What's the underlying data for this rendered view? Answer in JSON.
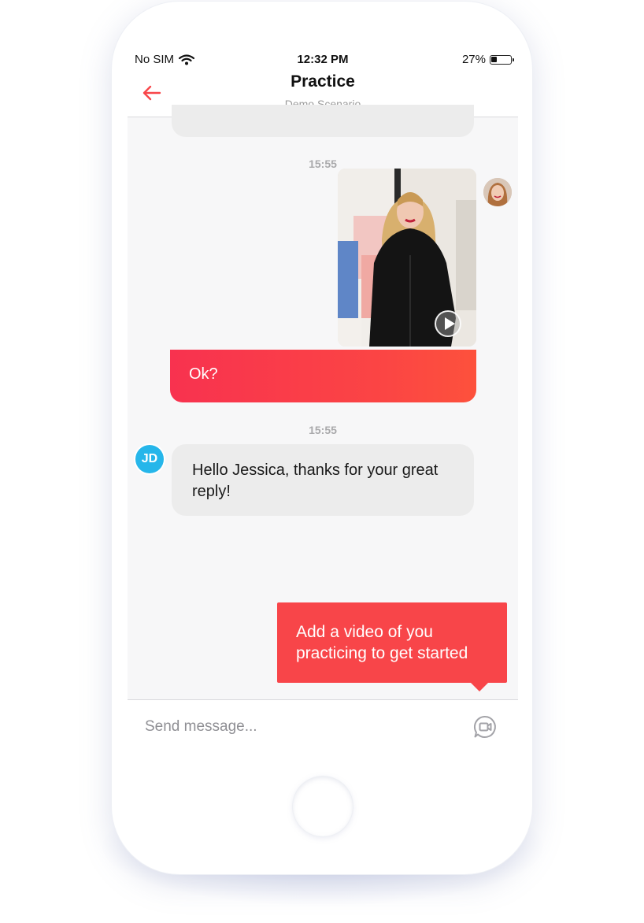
{
  "status_bar": {
    "carrier": "No SIM",
    "time": "12:32 PM",
    "battery_percent": "27%",
    "battery_level": 0.27,
    "icons": [
      "wifi-icon",
      "battery-icon"
    ]
  },
  "header": {
    "title": "Practice",
    "subtitle": "Demo Scenario",
    "back_icon": "arrow-left-icon",
    "accent_color": "#f84549"
  },
  "messages": [
    {
      "timestamp": "15:55",
      "attachment": "video",
      "play_icon": "play-icon",
      "text": "Ok?",
      "bubble_gradient": [
        "#f8324f",
        "#fd513c"
      ]
    },
    {
      "timestamp": "15:55",
      "avatar_initials": "JD",
      "avatar_color": "#26b6ea",
      "text": "Hello Jessica, thanks for your great reply!"
    }
  ],
  "tooltip": {
    "text": "Add a video of you practicing to get started",
    "color": "#f84549"
  },
  "composer": {
    "placeholder": "Send message...",
    "video_button_icon": "video-message-icon"
  }
}
